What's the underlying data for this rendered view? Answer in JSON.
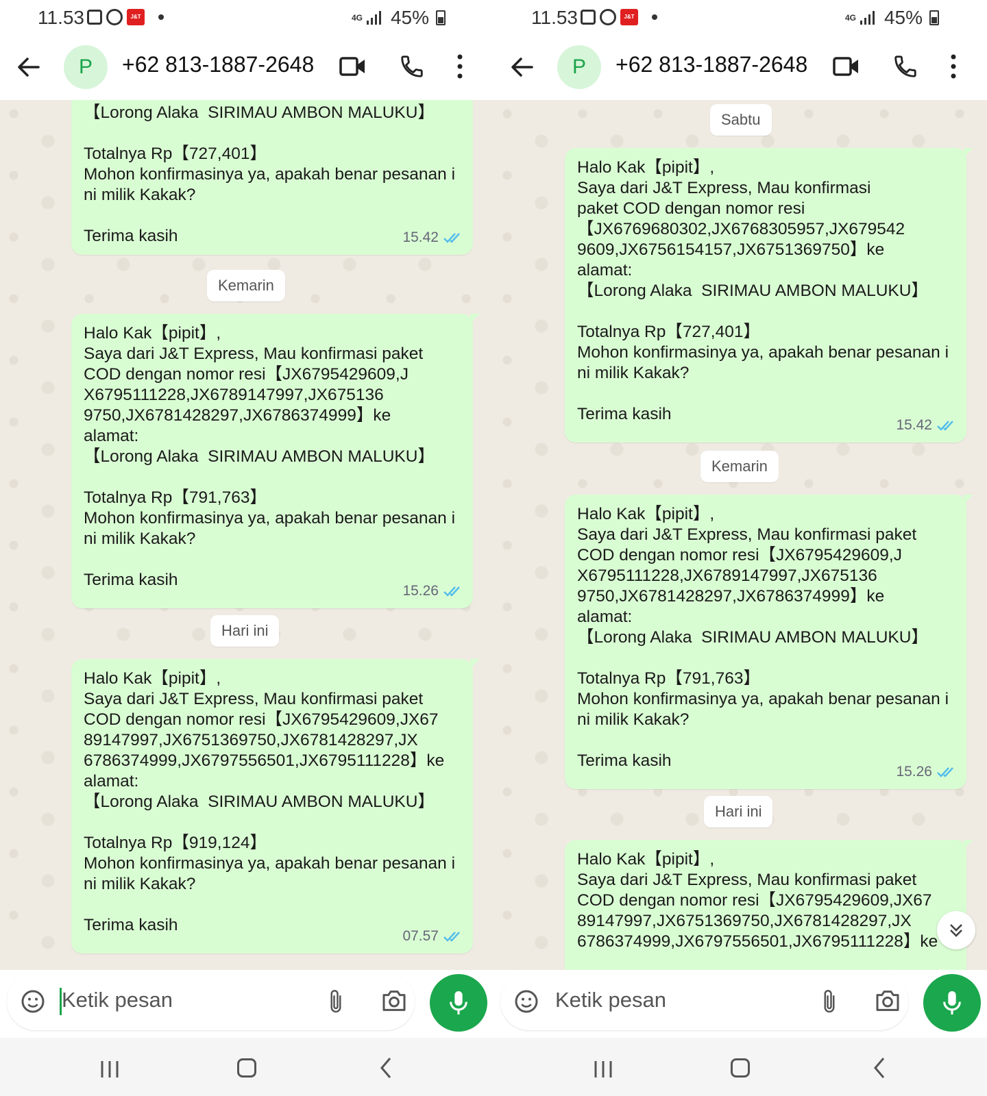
{
  "status": {
    "time": "11.53",
    "network": "4G",
    "battery": "45%"
  },
  "contact": {
    "avatar_letter": "P",
    "name": "+62 813-1887-2648"
  },
  "colors": {
    "bubble": "#d9fdd3",
    "accent": "#1ba74d",
    "tick": "#53bdeb",
    "chat_bg": "#efeae2"
  },
  "input": {
    "placeholder": "Ketik pesan"
  },
  "messages": {
    "m1": {
      "text": "Halo Kak【pipit】,\nSaya dari J&T Express, Mau konfirmasi\npaket COD dengan nomor resi\n【JX6769680302,JX6768305957,JX679542\n9609,JX6756154157,JX6751369750】ke\nalamat:\n【Lorong Alaka  SIRIMAU AMBON MALUKU】\n\nTotalnya Rp【727,401】\nMohon konfirmasinya ya, apakah benar pesanan ini milik Kakak?\n\nTerima kasih",
      "time": "15.42"
    },
    "m2": {
      "text": "Halo Kak【pipit】,\nSaya dari J&T Express, Mau konfirmasi paket\nCOD dengan nomor resi【JX6795429609,J\nX6795111228,JX6789147997,JX675136\n9750,JX6781428297,JX6786374999】ke\nalamat:\n【Lorong Alaka  SIRIMAU AMBON MALUKU】\n\nTotalnya Rp【791,763】\nMohon konfirmasinya ya, apakah benar pesanan ini milik Kakak?\n\nTerima kasih",
      "time": "15.26"
    },
    "m3": {
      "text": "Halo Kak【pipit】,\nSaya dari J&T Express, Mau konfirmasi paket\nCOD dengan nomor resi【JX6795429609,JX67\n89147997,JX6751369750,JX6781428297,JX\n6786374999,JX6797556501,JX6795111228】ke\nalamat:\n【Lorong Alaka  SIRIMAU AMBON MALUKU】\n\nTotalnya Rp【919,124】\nMohon konfirmasinya ya, apakah benar pesanan ini milik Kakak?\n\nTerima kasih",
      "time": "07.57"
    },
    "m1_tail": {
      "text": "【Lorong Alaka  SIRIMAU AMBON MALUKU】\n\nTotalnya Rp【727,401】\nMohon konfirmasinya ya, apakah benar pesanan ini milik Kakak?\n\nTerima kasih"
    },
    "m3_head": {
      "text": "Halo Kak【pipit】,\nSaya dari J&T Express, Mau konfirmasi paket\nCOD dengan nomor resi【JX6795429609,JX67\n89147997,JX6751369750,JX6781428297,JX\n6786374999,JX6797556501,JX6795111228】ke"
    }
  },
  "dates": {
    "sabtu": "Sabtu",
    "kemarin": "Kemarin",
    "hari_ini": "Hari ini"
  }
}
